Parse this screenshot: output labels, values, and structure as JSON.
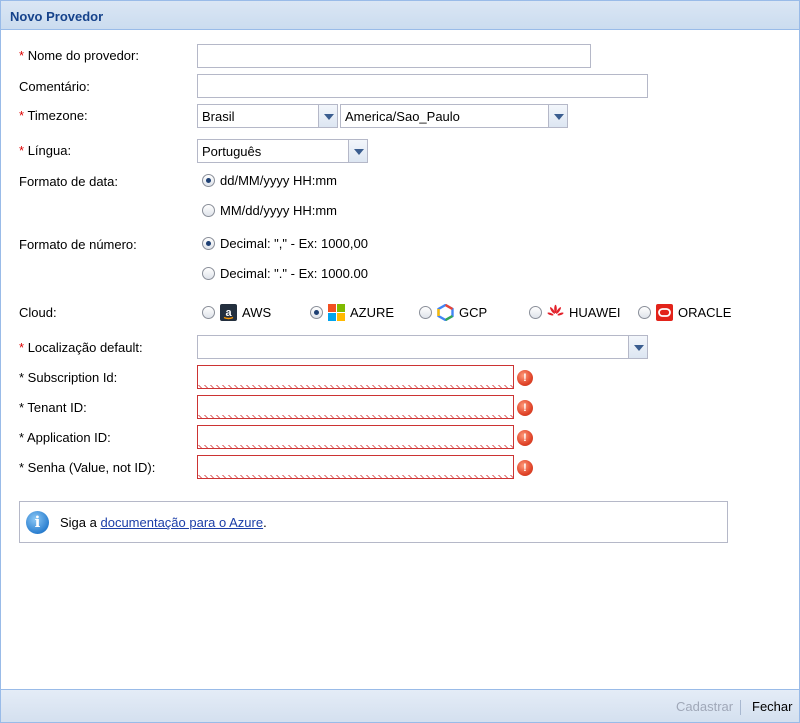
{
  "window": {
    "title": "Novo Provedor"
  },
  "form": {
    "nome_provedor": {
      "required_mark": "*",
      "label": "Nome do provedor:",
      "value": ""
    },
    "comentario": {
      "label": "Comentário:",
      "value": ""
    },
    "timezone": {
      "required_mark": "*",
      "label": "Timezone:",
      "country": "Brasil",
      "zone": "America/Sao_Paulo"
    },
    "lingua": {
      "required_mark": "*",
      "label": "Língua:",
      "value": "Português"
    },
    "formato_data": {
      "label": "Formato de data:",
      "options": [
        "dd/MM/yyyy HH:mm",
        "MM/dd/yyyy HH:mm"
      ],
      "selected": 0
    },
    "formato_numero": {
      "label": "Formato de número:",
      "options": [
        "Decimal: \",\" - Ex: 1000,00",
        "Decimal: \".\" - Ex: 1000.00"
      ],
      "selected": 0
    },
    "cloud": {
      "label": "Cloud:",
      "options": [
        {
          "label": "AWS",
          "icon": "aws-icon",
          "checked": false
        },
        {
          "label": "AZURE",
          "icon": "azure-icon",
          "checked": true
        },
        {
          "label": "GCP",
          "icon": "gcp-icon",
          "checked": false
        },
        {
          "label": "HUAWEI",
          "icon": "huawei-icon",
          "checked": false
        },
        {
          "label": "ORACLE",
          "icon": "oracle-icon",
          "checked": false
        }
      ]
    },
    "localizacao": {
      "required_mark": "*",
      "label": "Localização default:",
      "value": ""
    },
    "subscription_id": {
      "label": "* Subscription Id:",
      "value": ""
    },
    "tenant_id": {
      "label": "* Tenant ID:",
      "value": ""
    },
    "application_id": {
      "label": "* Application ID:",
      "value": ""
    },
    "senha": {
      "label": "* Senha (Value, not ID):",
      "value": ""
    }
  },
  "info": {
    "prefix": "Siga a ",
    "link_text": "documentação para o Azure",
    "suffix": "."
  },
  "footer": {
    "cadastrar_label": "Cadastrar",
    "fechar_label": "Fechar"
  },
  "colors": {
    "title_text": "#15428b",
    "required": "#dd0000",
    "invalid_border": "#cc3333",
    "disabled_text": "#a0a8b8",
    "link": "#1b3ea8"
  }
}
